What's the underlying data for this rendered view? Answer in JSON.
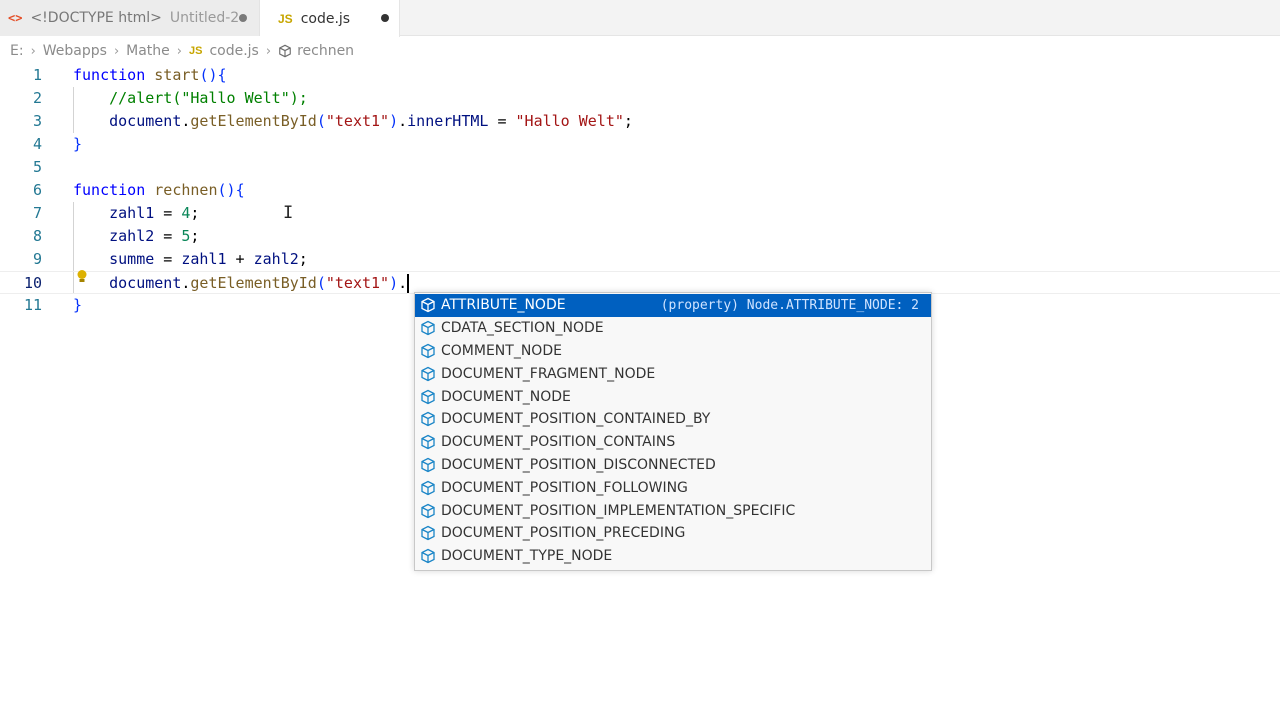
{
  "tabs": [
    {
      "icon": "<>",
      "label": "<!DOCTYPE html>",
      "description": "Untitled-2",
      "dirty": true,
      "active": false
    },
    {
      "icon": "JS",
      "label": "code.js",
      "dirty": true,
      "active": true
    }
  ],
  "breadcrumb": {
    "items": [
      "E:",
      "Webapps",
      "Mathe",
      "code.js",
      "rechnen"
    ],
    "file_icon": "JS"
  },
  "editor": {
    "current_line": 10,
    "lines": [
      {
        "n": "1",
        "text": "function start(){"
      },
      {
        "n": "2",
        "text": "    //alert(\"Hallo Welt\");"
      },
      {
        "n": "3",
        "text": "    document.getElementById(\"text1\").innerHTML = \"Hallo Welt\";"
      },
      {
        "n": "4",
        "text": "}"
      },
      {
        "n": "5",
        "text": ""
      },
      {
        "n": "6",
        "text": "function rechnen(){"
      },
      {
        "n": "7",
        "text": "    zahl1 = 4;"
      },
      {
        "n": "8",
        "text": "    zahl2 = 5;"
      },
      {
        "n": "9",
        "text": "    summe = zahl1 + zahl2;"
      },
      {
        "n": "10",
        "text": "    document.getElementById(\"text1\")."
      },
      {
        "n": "11",
        "text": "}"
      }
    ]
  },
  "suggestions": {
    "selected_detail": "(property) Node.ATTRIBUTE_NODE: 2",
    "items": [
      "ATTRIBUTE_NODE",
      "CDATA_SECTION_NODE",
      "COMMENT_NODE",
      "DOCUMENT_FRAGMENT_NODE",
      "DOCUMENT_NODE",
      "DOCUMENT_POSITION_CONTAINED_BY",
      "DOCUMENT_POSITION_CONTAINS",
      "DOCUMENT_POSITION_DISCONNECTED",
      "DOCUMENT_POSITION_FOLLOWING",
      "DOCUMENT_POSITION_IMPLEMENTATION_SPECIFIC",
      "DOCUMENT_POSITION_PRECEDING",
      "DOCUMENT_TYPE_NODE"
    ],
    "icon": "property-cube-icon"
  },
  "colors": {
    "selection": "#0060c0",
    "line_number": "#237893",
    "keyword": "#0000ff",
    "function": "#795e26",
    "comment": "#008000",
    "string": "#a31515",
    "number": "#098658",
    "variable": "#001080"
  }
}
